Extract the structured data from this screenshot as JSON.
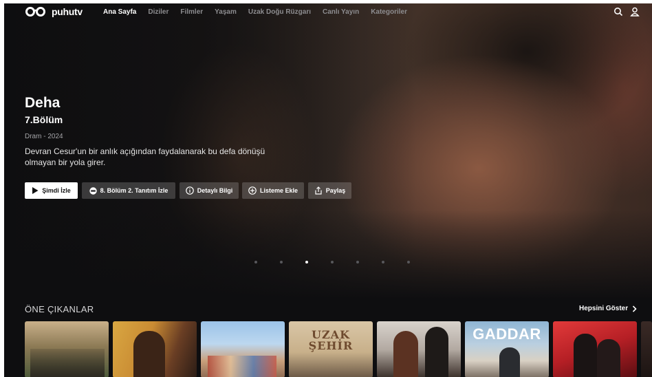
{
  "nav": {
    "logo_text": "puhutv",
    "links": [
      "Ana Sayfa",
      "Diziler",
      "Filmler",
      "Yaşam",
      "Uzak Doğu Rüzgarı",
      "Canlı Yayın",
      "Kategoriler"
    ],
    "active_index": 0
  },
  "hero": {
    "title": "Deha",
    "episode": "7.Bölüm",
    "meta": "Dram - 2024",
    "description": "Devran Cesur'un bir anlık açığından faydalanarak bu defa dönüşü olmayan bir yola girer.",
    "buttons": {
      "watch": "Şimdi İzle",
      "trailer": "8. Bölüm 2. Tanıtım İzle",
      "details": "Detaylı Bilgi",
      "add_list": "Listeme Ekle",
      "share": "Paylaş"
    },
    "carousel_total": 7,
    "carousel_active": 3
  },
  "featured": {
    "title": "ÖNE ÇIKANLAR",
    "see_all": "Hepsini Göster",
    "cards": [
      {
        "label": ""
      },
      {
        "label": ""
      },
      {
        "label": ""
      },
      {
        "label": "UZAK ŞEHİR"
      },
      {
        "label": ""
      },
      {
        "label": "GADDAR"
      },
      {
        "label": ""
      }
    ]
  },
  "colors": {
    "background": "#0e0e10",
    "nav_inactive": "#8d8d90",
    "button_bg": "rgba(255,255,255,0.18)",
    "primary_button": "#ffffff"
  },
  "icons": [
    "search-icon",
    "user-icon",
    "play-icon",
    "trailer-icon",
    "info-icon",
    "plus-icon",
    "share-icon",
    "chevron-right-icon"
  ]
}
